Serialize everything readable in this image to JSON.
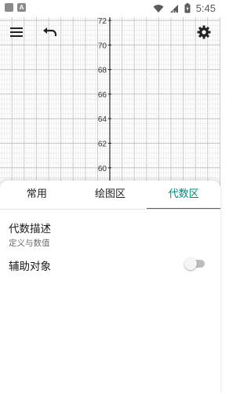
{
  "status_bar": {
    "time": "5:45",
    "left_icon_letter": "A"
  },
  "graph": {
    "y_ticks": [
      "72",
      "70",
      "68",
      "66",
      "64",
      "62",
      "60"
    ]
  },
  "toolbar": {
    "menu_icon": "menu-icon",
    "undo_icon": "undo-icon",
    "settings_icon": "gear-icon"
  },
  "tabs": [
    {
      "label": "常用",
      "active": false
    },
    {
      "label": "绘图区",
      "active": false
    },
    {
      "label": "代数区",
      "active": true
    }
  ],
  "algebra_description": {
    "title": "代数描述",
    "subtitle": "定义与数值"
  },
  "auxiliary_objects": {
    "label": "辅助对象",
    "enabled": false
  },
  "colors": {
    "accent": "#00897b",
    "grid_minor": "#e6e6e6",
    "grid_major": "#c4c4c4"
  }
}
